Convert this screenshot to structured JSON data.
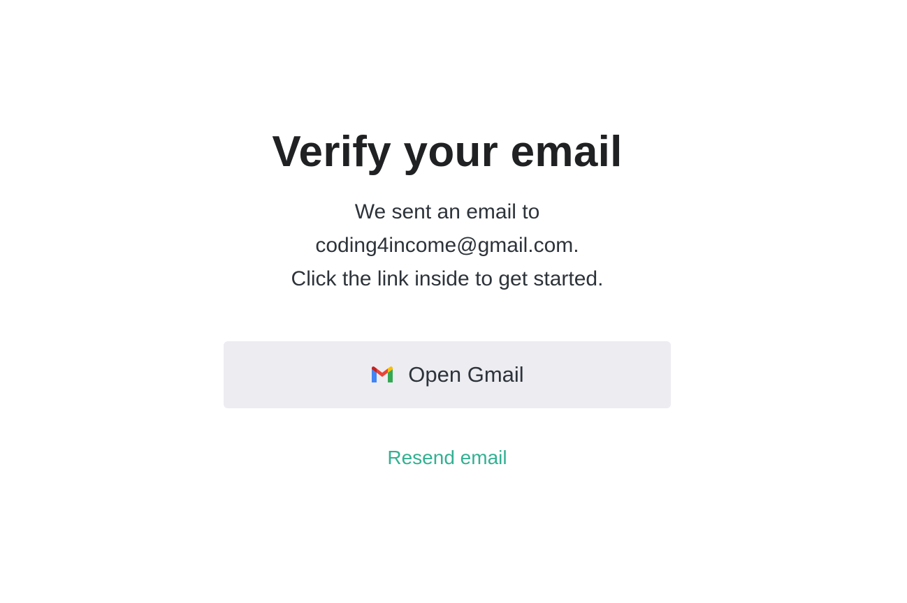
{
  "heading": "Verify your email",
  "message": {
    "line1": "We sent an email to",
    "email_line": "coding4income@gmail.com.",
    "line3": "Click the link inside to get started."
  },
  "gmail_button": {
    "icon": "gmail-icon",
    "label": "Open Gmail"
  },
  "resend_link": {
    "label": "Resend email"
  },
  "colors": {
    "heading": "#202123",
    "text": "#2d333a",
    "button_bg": "#ececf1",
    "link": "#10a37f",
    "background": "#ffffff"
  }
}
